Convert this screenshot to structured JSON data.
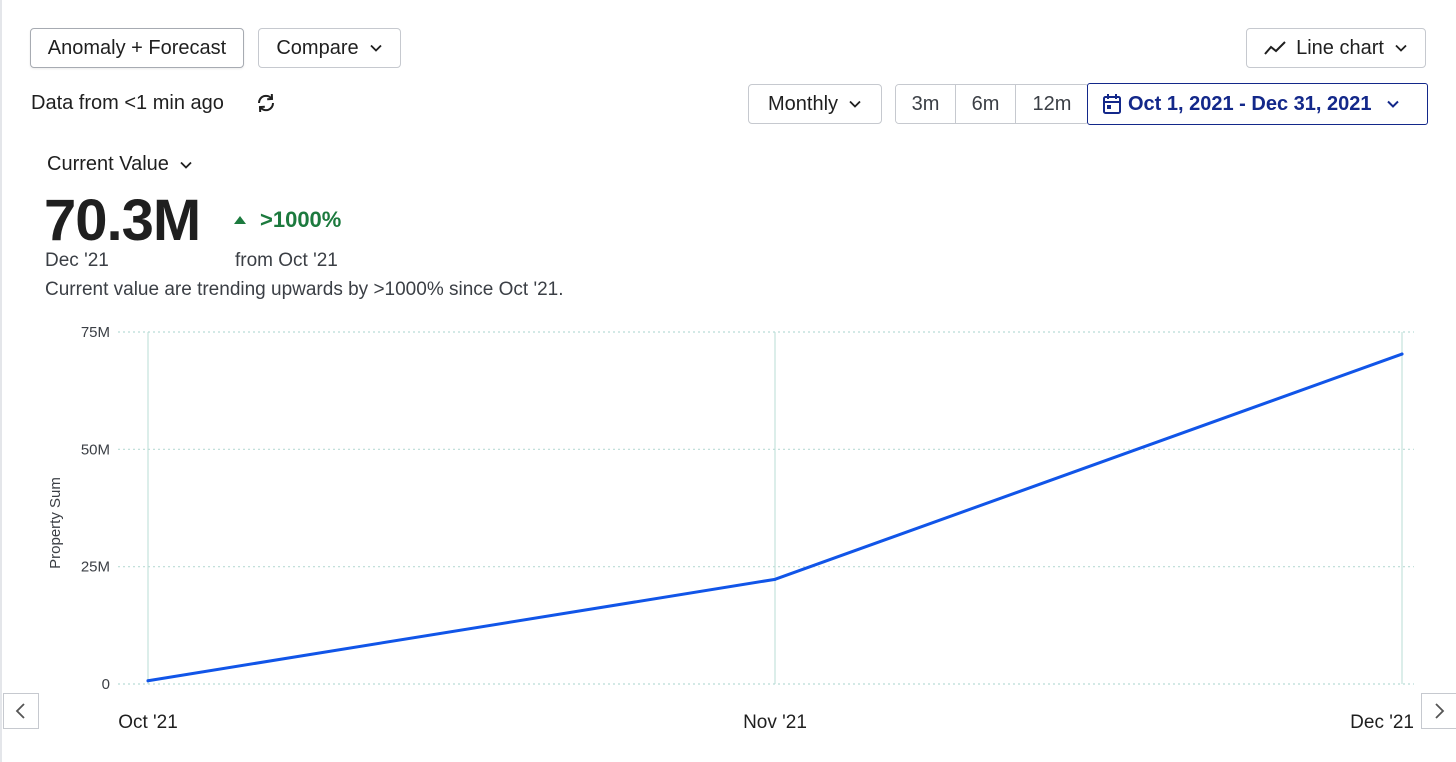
{
  "toolbar": {
    "anomaly_label": "Anomaly + Forecast",
    "compare_label": "Compare",
    "chart_type_label": "Line chart"
  },
  "status": {
    "data_age": "Data from <1 min ago"
  },
  "controls": {
    "interval_label": "Monthly",
    "ranges": [
      "3m",
      "6m",
      "12m"
    ],
    "date_range": "Oct 1, 2021 - Dec 31, 2021"
  },
  "metric": {
    "selector_label": "Current Value",
    "value": "70.3M",
    "period": "Dec '21",
    "change": ">1000%",
    "change_from": "from Oct '21",
    "summary": "Current value are trending upwards by >1000% since Oct '21."
  },
  "colors": {
    "line": "#1155e8",
    "positive": "#1c7a3e",
    "accent": "#13288a",
    "grid": "#b9dcd6"
  },
  "chart_data": {
    "type": "line",
    "categories": [
      "Oct '21",
      "Nov '21",
      "Dec '21"
    ],
    "series": [
      {
        "values": [
          0.7,
          22.3,
          70.3
        ]
      }
    ],
    "ylabel": "Property Sum",
    "yticks": [
      0,
      25,
      50,
      75
    ],
    "ytick_labels": [
      "0",
      "25M",
      "50M",
      "75M"
    ],
    "ylim": [
      0,
      75
    ],
    "grid": true
  }
}
